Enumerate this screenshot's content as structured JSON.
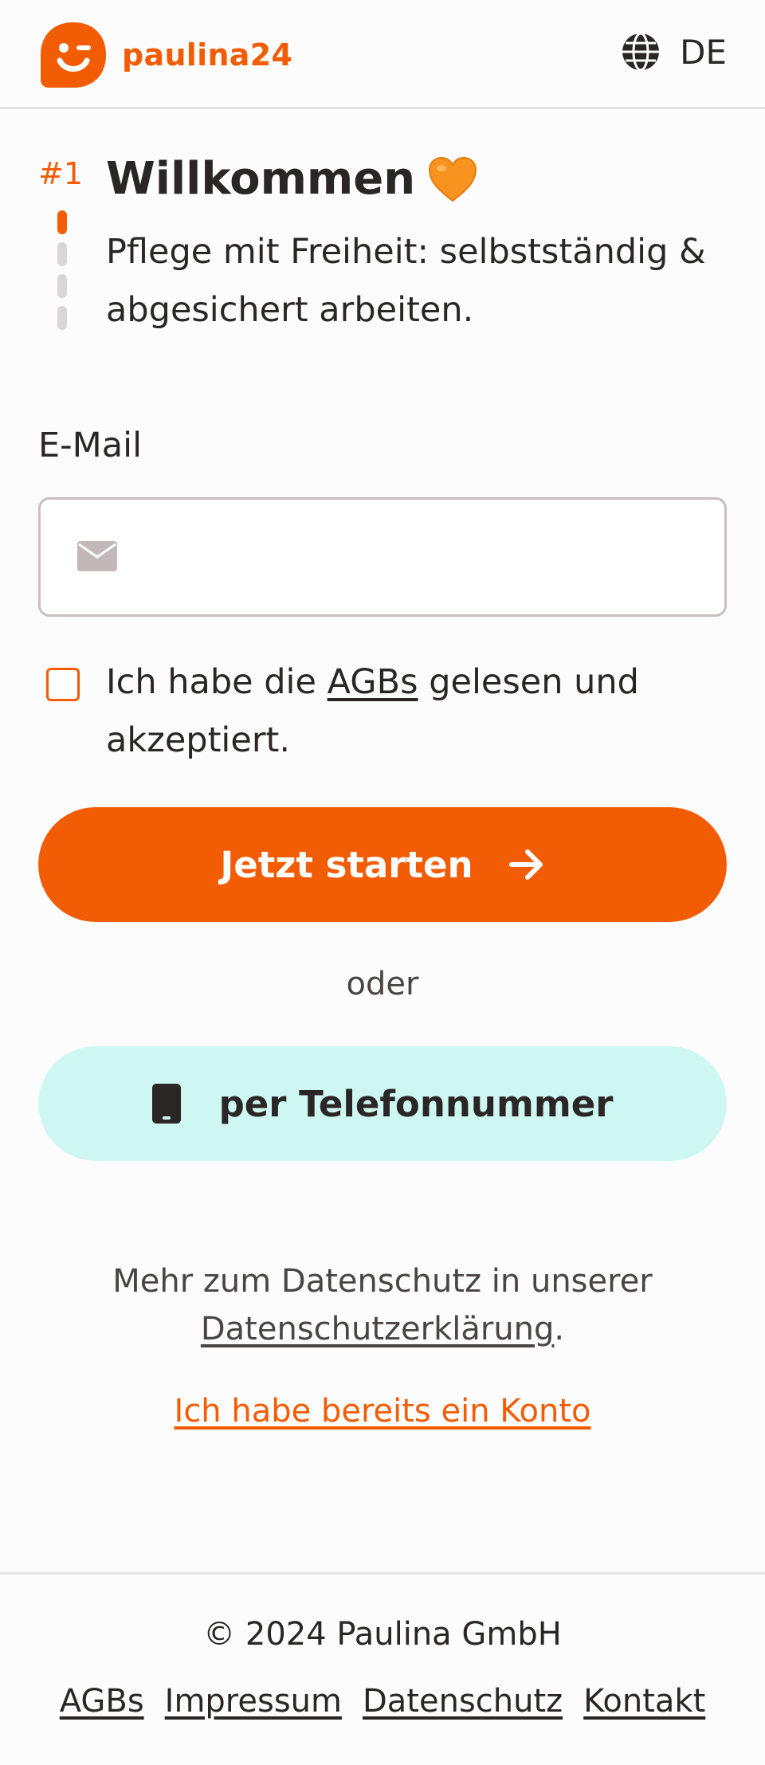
{
  "header": {
    "brand": "paulina24",
    "language": "DE",
    "brand_color": "#f25c05"
  },
  "intro": {
    "step": "#1",
    "progress": {
      "current": 1,
      "total": 4
    },
    "title": "Willkommen",
    "subtitle": "Pflege mit Freiheit: selbstständig & abgesichert arbeiten."
  },
  "form": {
    "email_label": "E-Mail",
    "email_value": "",
    "email_placeholder": "",
    "terms": {
      "checked": false,
      "before": "Ich habe die ",
      "link": "AGBs",
      "after": " gelesen und akzeptiert."
    },
    "submit_label": "Jetzt starten",
    "or_label": "oder",
    "phone_label": "per Telefonnummer"
  },
  "privacy": {
    "text": "Mehr zum Datenschutz in unserer",
    "link": "Datenschutzerklärung",
    "suffix": "."
  },
  "login_link": "Ich habe bereits ein Konto",
  "footer": {
    "copyright": "© 2024 Paulina GmbH",
    "links": [
      "AGBs",
      "Impressum",
      "Datenschutz",
      "Kontakt"
    ]
  },
  "icons": {
    "logo": "smiley-logo-icon",
    "language": "globe-icon",
    "title_emoji": "orange-heart-icon",
    "email": "envelope-icon",
    "submit": "arrow-right-icon",
    "phone": "smartphone-icon"
  }
}
